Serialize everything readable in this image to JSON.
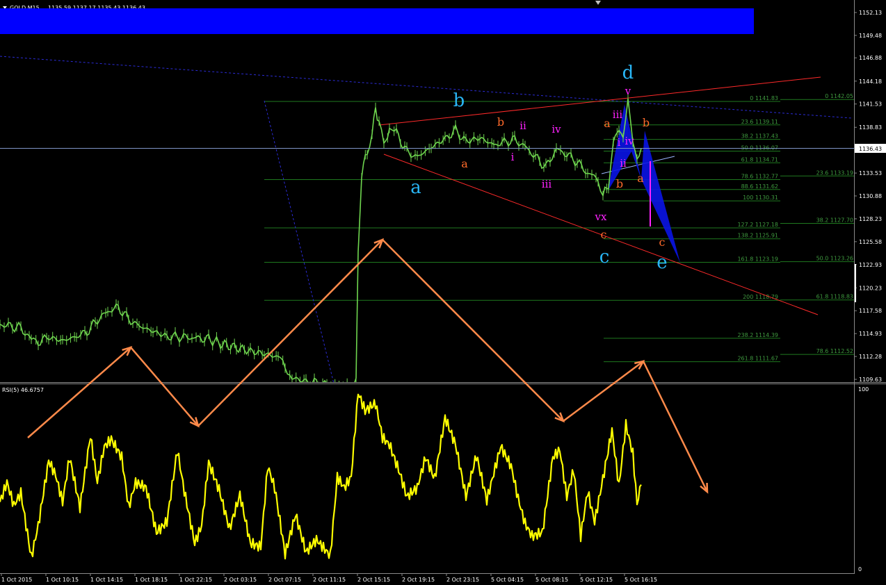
{
  "header": {
    "symbol_label": "GOLD,M15",
    "ohlc": "1135.59 1137.17 1135.43 1136.43"
  },
  "current_price": "1136.43",
  "rsi_label": "RSI(5) 46.6757",
  "colors": {
    "background": "#000000",
    "candles": "#6fd64f",
    "rsi": "#ffff00",
    "banner": "#0000ff",
    "fib_lines": "#1f7a1f",
    "fib_text": "#3f9a3f",
    "trend_red": "#ff2a2a",
    "trend_blue_dashed": "#2b2bd6",
    "arrow_orange": "#ff8a4a",
    "wave_cyan": "#29b6f6",
    "wave_orange": "#ff6a2a",
    "wave_magenta": "#ff22ff",
    "harmonic_fill": "#0a14e6"
  },
  "chart_data": {
    "type": "line",
    "symbol": "GOLD",
    "timeframe": "M15",
    "price_axis": {
      "ticks": [
        "1152.13",
        "1149.48",
        "1146.88",
        "1144.18",
        "1141.53",
        "1138.83",
        "1136.18",
        "1133.53",
        "1130.88",
        "1128.23",
        "1125.58",
        "1122.93",
        "1120.23",
        "1117.58",
        "1114.93",
        "1112.28",
        "1109.63"
      ]
    },
    "time_axis": {
      "labels": [
        "1 Oct 2015",
        "1 Oct 10:15",
        "1 Oct 14:15",
        "1 Oct 18:15",
        "1 Oct 22:15",
        "2 Oct 03:15",
        "2 Oct 07:15",
        "2 Oct 11:15",
        "2 Oct 15:15",
        "2 Oct 19:15",
        "2 Oct 23:15",
        "5 Oct 04:15",
        "5 Oct 08:15",
        "5 Oct 12:15",
        "5 Oct 16:15"
      ]
    },
    "price_series": {
      "name": "GOLD,M15",
      "points": [
        [
          0,
          1116.0
        ],
        [
          30,
          1115.6
        ],
        [
          45,
          1114.2
        ],
        [
          55,
          1114.0
        ],
        [
          70,
          1114.5
        ],
        [
          90,
          1114.1
        ],
        [
          110,
          1114.6
        ],
        [
          125,
          1115.1
        ],
        [
          140,
          1116.5
        ],
        [
          155,
          1117.5
        ],
        [
          170,
          1118.0
        ],
        [
          185,
          1116.6
        ],
        [
          200,
          1115.8
        ],
        [
          220,
          1115.2
        ],
        [
          240,
          1114.6
        ],
        [
          270,
          1114.5
        ],
        [
          300,
          1114.3
        ],
        [
          320,
          1113.7
        ],
        [
          340,
          1113.3
        ],
        [
          360,
          1112.9
        ],
        [
          380,
          1112.6
        ],
        [
          400,
          1112.2
        ],
        [
          410,
          1111.2
        ],
        [
          420,
          1109.8
        ],
        [
          440,
          1109.4
        ],
        [
          470,
          1109.0
        ],
        [
          505,
          1108.9
        ],
        [
          512,
          1109.6
        ],
        [
          515,
          1124.0
        ],
        [
          520,
          1133.5
        ],
        [
          528,
          1136.0
        ],
        [
          535,
          1138.2
        ],
        [
          540,
          1141.0
        ],
        [
          545,
          1139.5
        ],
        [
          552,
          1136.8
        ],
        [
          560,
          1138.5
        ],
        [
          570,
          1138.2
        ],
        [
          585,
          1136.0
        ],
        [
          600,
          1135.4
        ],
        [
          620,
          1136.5
        ],
        [
          640,
          1137.5
        ],
        [
          655,
          1138.5
        ],
        [
          670,
          1137.2
        ],
        [
          690,
          1137.6
        ],
        [
          710,
          1136.8
        ],
        [
          725,
          1137.1
        ],
        [
          740,
          1137.4
        ],
        [
          755,
          1136.6
        ],
        [
          770,
          1135.4
        ],
        [
          785,
          1134.2
        ],
        [
          800,
          1136.3
        ],
        [
          815,
          1135.7
        ],
        [
          830,
          1134.8
        ],
        [
          845,
          1133.5
        ],
        [
          860,
          1132.9
        ],
        [
          867,
          1130.9
        ],
        [
          875,
          1132.3
        ],
        [
          882,
          1137.3
        ],
        [
          890,
          1138.7
        ],
        [
          896,
          1137.6
        ],
        [
          903,
          1141.6
        ],
        [
          910,
          1137.0
        ],
        [
          916,
          1135.2
        ],
        [
          922,
          1136.4
        ]
      ]
    },
    "rsi_series": {
      "name": "RSI(5)",
      "last_value": 46.6757,
      "ylim": [
        0,
        100
      ],
      "axis_labels": [
        "100",
        "0"
      ],
      "points": [
        [
          0,
          37
        ],
        [
          10,
          48
        ],
        [
          20,
          35
        ],
        [
          30,
          42
        ],
        [
          45,
          6
        ],
        [
          55,
          24
        ],
        [
          70,
          60
        ],
        [
          80,
          52
        ],
        [
          90,
          37
        ],
        [
          100,
          62
        ],
        [
          115,
          34
        ],
        [
          130,
          74
        ],
        [
          140,
          48
        ],
        [
          150,
          68
        ],
        [
          160,
          72
        ],
        [
          175,
          62
        ],
        [
          185,
          34
        ],
        [
          195,
          48
        ],
        [
          210,
          45
        ],
        [
          225,
          20
        ],
        [
          240,
          26
        ],
        [
          255,
          66
        ],
        [
          265,
          43
        ],
        [
          280,
          14
        ],
        [
          290,
          24
        ],
        [
          300,
          59
        ],
        [
          315,
          44
        ],
        [
          330,
          22
        ],
        [
          345,
          41
        ],
        [
          360,
          14
        ],
        [
          375,
          12
        ],
        [
          385,
          57
        ],
        [
          395,
          45
        ],
        [
          410,
          8
        ],
        [
          425,
          30
        ],
        [
          440,
          9
        ],
        [
          455,
          16
        ],
        [
          475,
          7
        ],
        [
          485,
          51
        ],
        [
          495,
          45
        ],
        [
          505,
          51
        ],
        [
          515,
          98
        ],
        [
          525,
          88
        ],
        [
          540,
          92
        ],
        [
          550,
          73
        ],
        [
          560,
          69
        ],
        [
          575,
          53
        ],
        [
          585,
          40
        ],
        [
          600,
          45
        ],
        [
          612,
          62
        ],
        [
          625,
          50
        ],
        [
          640,
          84
        ],
        [
          655,
          69
        ],
        [
          670,
          40
        ],
        [
          685,
          63
        ],
        [
          700,
          38
        ],
        [
          720,
          68
        ],
        [
          735,
          57
        ],
        [
          745,
          39
        ],
        [
          755,
          25
        ],
        [
          765,
          18
        ],
        [
          780,
          20
        ],
        [
          795,
          62
        ],
        [
          805,
          66
        ],
        [
          815,
          40
        ],
        [
          825,
          55
        ],
        [
          835,
          18
        ],
        [
          845,
          43
        ],
        [
          855,
          26
        ],
        [
          865,
          46
        ],
        [
          880,
          77
        ],
        [
          890,
          46
        ],
        [
          900,
          80
        ],
        [
          910,
          64
        ],
        [
          916,
          36
        ],
        [
          922,
          46.6757
        ]
      ]
    },
    "fibonacci_levels_upper": [
      "0 1141.83",
      "23.6 1139.11",
      "38.2 1137.43",
      "50.0 1136.07",
      "61.8 1134.71",
      "78.6 1132.77",
      "88.6 1131.62",
      "100 1130.31",
      "127.2 1127.18",
      "138.2 1125.91",
      "161.8 1123.19",
      "200 1118.79",
      "238.2 1114.39",
      "261.8 1111.67"
    ],
    "fibonacci_levels_right": [
      "0 1142.05",
      "23.6 1133.19",
      "38.2 1127.70",
      "50.0 1123.26",
      "61.8 1118.83",
      "78.6 1112.52"
    ],
    "wave_labels": [
      {
        "text": "a",
        "color": "cyan"
      },
      {
        "text": "b",
        "color": "cyan"
      },
      {
        "text": "c",
        "color": "cyan"
      },
      {
        "text": "d",
        "color": "cyan"
      },
      {
        "text": "e",
        "color": "cyan"
      },
      {
        "text": "a",
        "color": "orange"
      },
      {
        "text": "b",
        "color": "orange"
      },
      {
        "text": "a",
        "color": "orange"
      },
      {
        "text": "c",
        "color": "orange"
      },
      {
        "text": "b",
        "color": "orange"
      },
      {
        "text": "b",
        "color": "orange"
      },
      {
        "text": "a",
        "color": "orange"
      },
      {
        "text": "c",
        "color": "orange"
      },
      {
        "text": "ii",
        "color": "magenta"
      },
      {
        "text": "iv",
        "color": "magenta"
      },
      {
        "text": "i",
        "color": "magenta"
      },
      {
        "text": "iii",
        "color": "magenta"
      },
      {
        "text": "vx",
        "color": "magenta"
      },
      {
        "text": "iii",
        "color": "magenta"
      },
      {
        "text": "i",
        "color": "magenta"
      },
      {
        "text": "iv",
        "color": "magenta"
      },
      {
        "text": "ii",
        "color": "magenta"
      },
      {
        "text": "v",
        "color": "magenta"
      }
    ]
  }
}
